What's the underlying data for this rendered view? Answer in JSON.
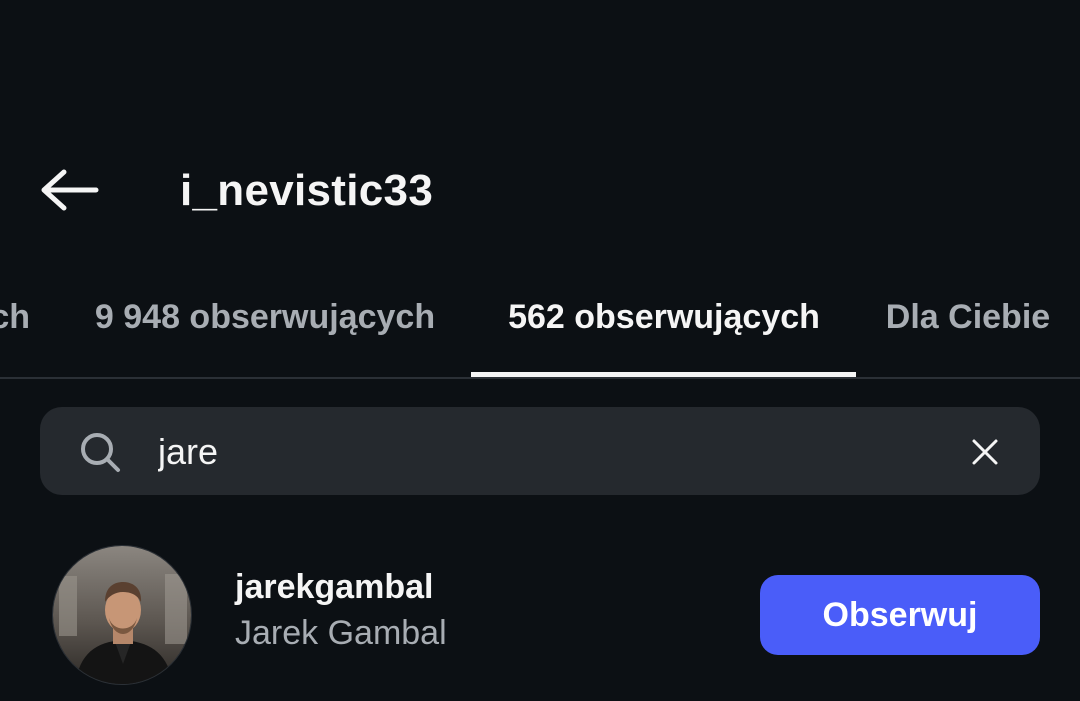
{
  "header": {
    "title": "i_nevistic33",
    "back_icon": "arrow-left-icon"
  },
  "tabs": [
    {
      "label": "ch",
      "active": false
    },
    {
      "label": "9 948 obserwujących",
      "active": false
    },
    {
      "label": "562 obserwujących",
      "active": true
    },
    {
      "label": "Dla Ciebie",
      "active": false
    }
  ],
  "search": {
    "value": "jare",
    "search_icon": "search-icon",
    "clear_icon": "close-icon"
  },
  "results": [
    {
      "username": "jarekgambal",
      "full_name": "Jarek Gambal",
      "button_label": "Obserwuj",
      "avatar_icon": "avatar"
    }
  ],
  "colors": {
    "background": "#0c1014",
    "search_bg": "#25292e",
    "accent": "#4a5df9",
    "text_primary": "#f5f5f5",
    "text_secondary": "#a8adb3"
  }
}
